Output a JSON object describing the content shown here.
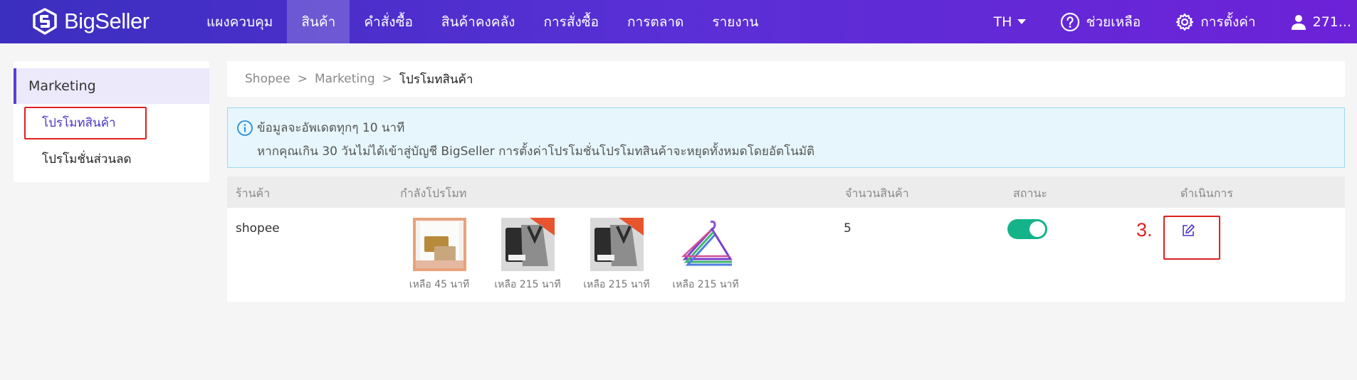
{
  "brand": {
    "name": "BigSeller"
  },
  "nav": {
    "items": [
      "แผงควบคุม",
      "สินค้า",
      "คำสั่งซื้อ",
      "สินค้าคงคลัง",
      "การสั่งซื้อ",
      "การตลาด",
      "รายงาน"
    ],
    "active_index": 1,
    "language": "TH",
    "help": "ช่วยเหลือ",
    "settings": "การตั้งค่า",
    "user": "271..."
  },
  "sidebar": {
    "heading": "Marketing",
    "items": [
      "โปรโมทสินค้า",
      "โปรโมชั่นส่วนลด"
    ],
    "active_index": 0
  },
  "breadcrumb": {
    "items": [
      "Shopee",
      "Marketing",
      "โปรโมทสินค้า"
    ],
    "separator": ">"
  },
  "notice": {
    "line1": "ข้อมูลจะอัพเดตทุกๆ 10 นาที",
    "line2": "หากคุณเกิน 30 วันไม่ได้เข้าสู่บัญชี BigSeller การตั้งค่าโปรโมชั่นโปรโมทสินค้าจะหยุดทั้งหมดโดยอัตโนมัติ"
  },
  "table": {
    "headers": {
      "shop": "ร้านค้า",
      "promoting": "กำลังโปรโมท",
      "count": "จำนวนสินค้า",
      "status": "สถานะ",
      "actions": "ดำเนินการ"
    },
    "rows": [
      {
        "shop": "shopee",
        "count": "5",
        "status_on": true,
        "promos": [
          {
            "image": "leather-wallet",
            "caption": "เหลือ 45 นาที"
          },
          {
            "image": "knit-vest",
            "caption": "เหลือ 215 นาที"
          },
          {
            "image": "knit-vest",
            "caption": "เหลือ 215 นาที"
          },
          {
            "image": "hangers",
            "caption": "เหลือ 215 นาที"
          }
        ]
      }
    ]
  },
  "annotation": {
    "step": "3."
  },
  "colors": {
    "nav_start": "#3b2fbf",
    "nav_end": "#6d22d8",
    "accent": "#5b3fd6",
    "toggle_on": "#14b38a",
    "highlight": "#e02020"
  }
}
